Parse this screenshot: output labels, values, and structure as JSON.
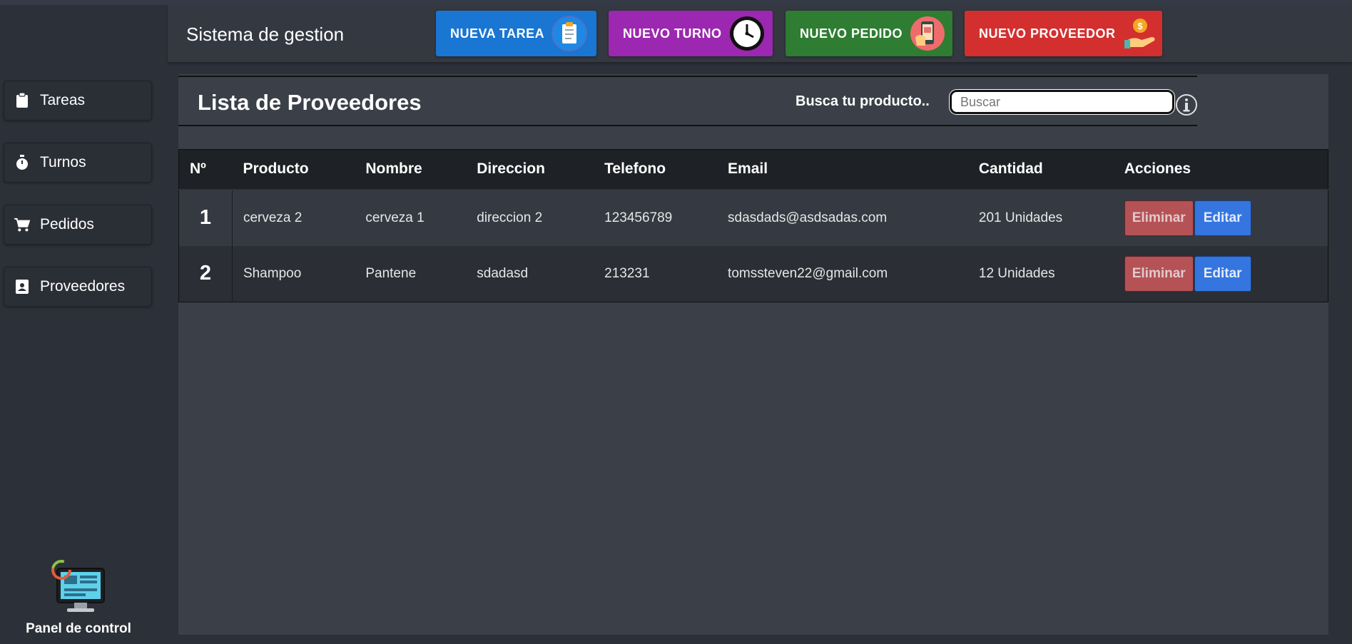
{
  "app": {
    "title": "Sistema de gestion"
  },
  "header_buttons": [
    {
      "label": "NUEVA TAREA",
      "icon": "clipboard-icon",
      "color": "#1976d2"
    },
    {
      "label": "NUEVO TURNO",
      "icon": "clock-icon",
      "color": "#9c27b0"
    },
    {
      "label": "NUEVO PEDIDO",
      "icon": "phone-order-icon",
      "color": "#2e7d32"
    },
    {
      "label": "NUEVO PROVEEDOR",
      "icon": "money-hand-icon",
      "color": "#d32f2f"
    }
  ],
  "sidebar": {
    "items": [
      {
        "label": "Tareas",
        "icon": "clipboard-icon"
      },
      {
        "label": "Turnos",
        "icon": "stopwatch-icon"
      },
      {
        "label": "Pedidos",
        "icon": "cart-icon"
      },
      {
        "label": "Proveedores",
        "icon": "contact-book-icon"
      }
    ],
    "panel_label": "Panel de control"
  },
  "main": {
    "title": "Lista de Proveedores",
    "search": {
      "label": "Busca tu producto..",
      "placeholder": "Buscar"
    },
    "table": {
      "headers": [
        "Nº",
        "Producto",
        "Nombre",
        "Direccion",
        "Telefono",
        "Email",
        "Cantidad",
        "Acciones"
      ],
      "rows": [
        {
          "num": "1",
          "producto": "cerveza 2",
          "nombre": "cerveza 1",
          "direccion": "direccion 2",
          "telefono": "123456789",
          "email": "sdasdads@asdsadas.com",
          "cantidad": "201 Unidades"
        },
        {
          "num": "2",
          "producto": "Shampoo",
          "nombre": "Pantene",
          "direccion": "sdadasd",
          "telefono": "213231",
          "email": "tomssteven22@gmail.com",
          "cantidad": "12 Unidades"
        }
      ],
      "actions": {
        "delete": "Eliminar",
        "edit": "Editar"
      }
    }
  },
  "colors": {
    "delete": "#b55256",
    "edit": "#3475e0",
    "background": "#2c3038",
    "content": "#3a3f48"
  }
}
